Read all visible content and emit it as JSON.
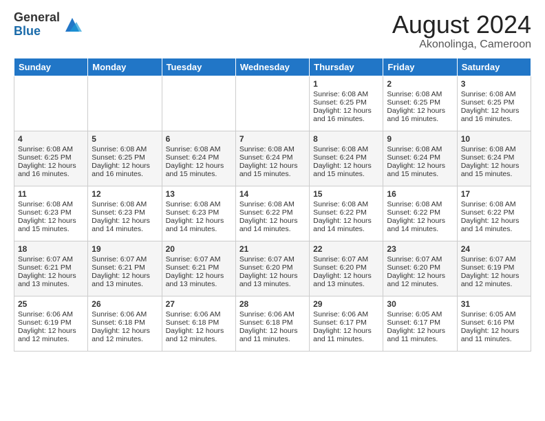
{
  "logo": {
    "general": "General",
    "blue": "Blue"
  },
  "title": "August 2024",
  "location": "Akonolinga, Cameroon",
  "days_header": [
    "Sunday",
    "Monday",
    "Tuesday",
    "Wednesday",
    "Thursday",
    "Friday",
    "Saturday"
  ],
  "weeks": [
    [
      {
        "day": "",
        "info": ""
      },
      {
        "day": "",
        "info": ""
      },
      {
        "day": "",
        "info": ""
      },
      {
        "day": "",
        "info": ""
      },
      {
        "day": "1",
        "info": "Sunrise: 6:08 AM\nSunset: 6:25 PM\nDaylight: 12 hours\nand 16 minutes."
      },
      {
        "day": "2",
        "info": "Sunrise: 6:08 AM\nSunset: 6:25 PM\nDaylight: 12 hours\nand 16 minutes."
      },
      {
        "day": "3",
        "info": "Sunrise: 6:08 AM\nSunset: 6:25 PM\nDaylight: 12 hours\nand 16 minutes."
      }
    ],
    [
      {
        "day": "4",
        "info": "Sunrise: 6:08 AM\nSunset: 6:25 PM\nDaylight: 12 hours\nand 16 minutes."
      },
      {
        "day": "5",
        "info": "Sunrise: 6:08 AM\nSunset: 6:25 PM\nDaylight: 12 hours\nand 16 minutes."
      },
      {
        "day": "6",
        "info": "Sunrise: 6:08 AM\nSunset: 6:24 PM\nDaylight: 12 hours\nand 15 minutes."
      },
      {
        "day": "7",
        "info": "Sunrise: 6:08 AM\nSunset: 6:24 PM\nDaylight: 12 hours\nand 15 minutes."
      },
      {
        "day": "8",
        "info": "Sunrise: 6:08 AM\nSunset: 6:24 PM\nDaylight: 12 hours\nand 15 minutes."
      },
      {
        "day": "9",
        "info": "Sunrise: 6:08 AM\nSunset: 6:24 PM\nDaylight: 12 hours\nand 15 minutes."
      },
      {
        "day": "10",
        "info": "Sunrise: 6:08 AM\nSunset: 6:24 PM\nDaylight: 12 hours\nand 15 minutes."
      }
    ],
    [
      {
        "day": "11",
        "info": "Sunrise: 6:08 AM\nSunset: 6:23 PM\nDaylight: 12 hours\nand 15 minutes."
      },
      {
        "day": "12",
        "info": "Sunrise: 6:08 AM\nSunset: 6:23 PM\nDaylight: 12 hours\nand 14 minutes."
      },
      {
        "day": "13",
        "info": "Sunrise: 6:08 AM\nSunset: 6:23 PM\nDaylight: 12 hours\nand 14 minutes."
      },
      {
        "day": "14",
        "info": "Sunrise: 6:08 AM\nSunset: 6:22 PM\nDaylight: 12 hours\nand 14 minutes."
      },
      {
        "day": "15",
        "info": "Sunrise: 6:08 AM\nSunset: 6:22 PM\nDaylight: 12 hours\nand 14 minutes."
      },
      {
        "day": "16",
        "info": "Sunrise: 6:08 AM\nSunset: 6:22 PM\nDaylight: 12 hours\nand 14 minutes."
      },
      {
        "day": "17",
        "info": "Sunrise: 6:08 AM\nSunset: 6:22 PM\nDaylight: 12 hours\nand 14 minutes."
      }
    ],
    [
      {
        "day": "18",
        "info": "Sunrise: 6:07 AM\nSunset: 6:21 PM\nDaylight: 12 hours\nand 13 minutes."
      },
      {
        "day": "19",
        "info": "Sunrise: 6:07 AM\nSunset: 6:21 PM\nDaylight: 12 hours\nand 13 minutes."
      },
      {
        "day": "20",
        "info": "Sunrise: 6:07 AM\nSunset: 6:21 PM\nDaylight: 12 hours\nand 13 minutes."
      },
      {
        "day": "21",
        "info": "Sunrise: 6:07 AM\nSunset: 6:20 PM\nDaylight: 12 hours\nand 13 minutes."
      },
      {
        "day": "22",
        "info": "Sunrise: 6:07 AM\nSunset: 6:20 PM\nDaylight: 12 hours\nand 13 minutes."
      },
      {
        "day": "23",
        "info": "Sunrise: 6:07 AM\nSunset: 6:20 PM\nDaylight: 12 hours\nand 12 minutes."
      },
      {
        "day": "24",
        "info": "Sunrise: 6:07 AM\nSunset: 6:19 PM\nDaylight: 12 hours\nand 12 minutes."
      }
    ],
    [
      {
        "day": "25",
        "info": "Sunrise: 6:06 AM\nSunset: 6:19 PM\nDaylight: 12 hours\nand 12 minutes."
      },
      {
        "day": "26",
        "info": "Sunrise: 6:06 AM\nSunset: 6:18 PM\nDaylight: 12 hours\nand 12 minutes."
      },
      {
        "day": "27",
        "info": "Sunrise: 6:06 AM\nSunset: 6:18 PM\nDaylight: 12 hours\nand 12 minutes."
      },
      {
        "day": "28",
        "info": "Sunrise: 6:06 AM\nSunset: 6:18 PM\nDaylight: 12 hours\nand 11 minutes."
      },
      {
        "day": "29",
        "info": "Sunrise: 6:06 AM\nSunset: 6:17 PM\nDaylight: 12 hours\nand 11 minutes."
      },
      {
        "day": "30",
        "info": "Sunrise: 6:05 AM\nSunset: 6:17 PM\nDaylight: 12 hours\nand 11 minutes."
      },
      {
        "day": "31",
        "info": "Sunrise: 6:05 AM\nSunset: 6:16 PM\nDaylight: 12 hours\nand 11 minutes."
      }
    ]
  ]
}
